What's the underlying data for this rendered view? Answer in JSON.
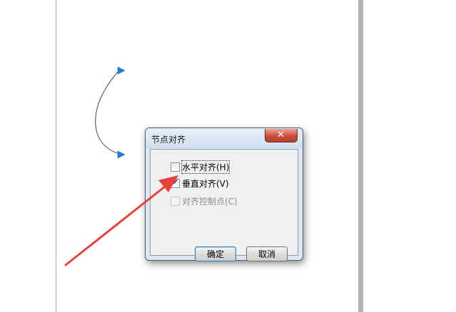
{
  "dialog": {
    "title": "节点对齐",
    "close_icon": "close-icon",
    "options": [
      {
        "label": "水平对齐(H)",
        "checked": false,
        "enabled": true,
        "focused": true
      },
      {
        "label": "垂直对齐(V)",
        "checked": true,
        "enabled": true,
        "focused": false
      },
      {
        "label": "对齐控制点(C)",
        "checked": false,
        "enabled": false,
        "focused": false
      }
    ],
    "ok_label": "确定",
    "cancel_label": "取消"
  },
  "colors": {
    "arrow": "#e8403a",
    "node_marker": "#1f7fd6",
    "curve": "#6b3a3a"
  },
  "icons": [
    "close-icon",
    "check-mark-icon",
    "node-marker-icon",
    "annotation-arrow-icon"
  ]
}
